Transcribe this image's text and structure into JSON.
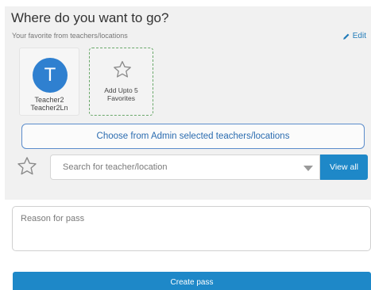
{
  "header": {
    "title": "Where do you want to go?",
    "subtitle": "Your favorite from teachers/locations",
    "edit_label": "Edit"
  },
  "favorites": {
    "items": [
      {
        "initial": "T",
        "first_name": "Teacher2",
        "last_name": "Teacher2Ln",
        "avatar_color": "#2f80d0"
      }
    ],
    "add_card": {
      "line1": "Add Upto 5",
      "line2": "Favorites"
    }
  },
  "admin_selection": {
    "label": "Choose from Admin selected teachers/locations"
  },
  "search": {
    "placeholder": "Search for teacher/location",
    "value": "",
    "view_all_label": "View all"
  },
  "reason": {
    "placeholder": "Reason for pass",
    "value": ""
  },
  "actions": {
    "create_label": "Create pass"
  },
  "colors": {
    "accent": "#1e88c8",
    "link": "#1f7ab8",
    "panel_bg": "#f1f1f1",
    "favorite_border": "#6aa86a"
  },
  "icons": {
    "edit": "pencil-icon",
    "add_favorite": "star-outline-icon",
    "search_favorite": "star-outline-icon",
    "dropdown": "caret-down-icon"
  }
}
